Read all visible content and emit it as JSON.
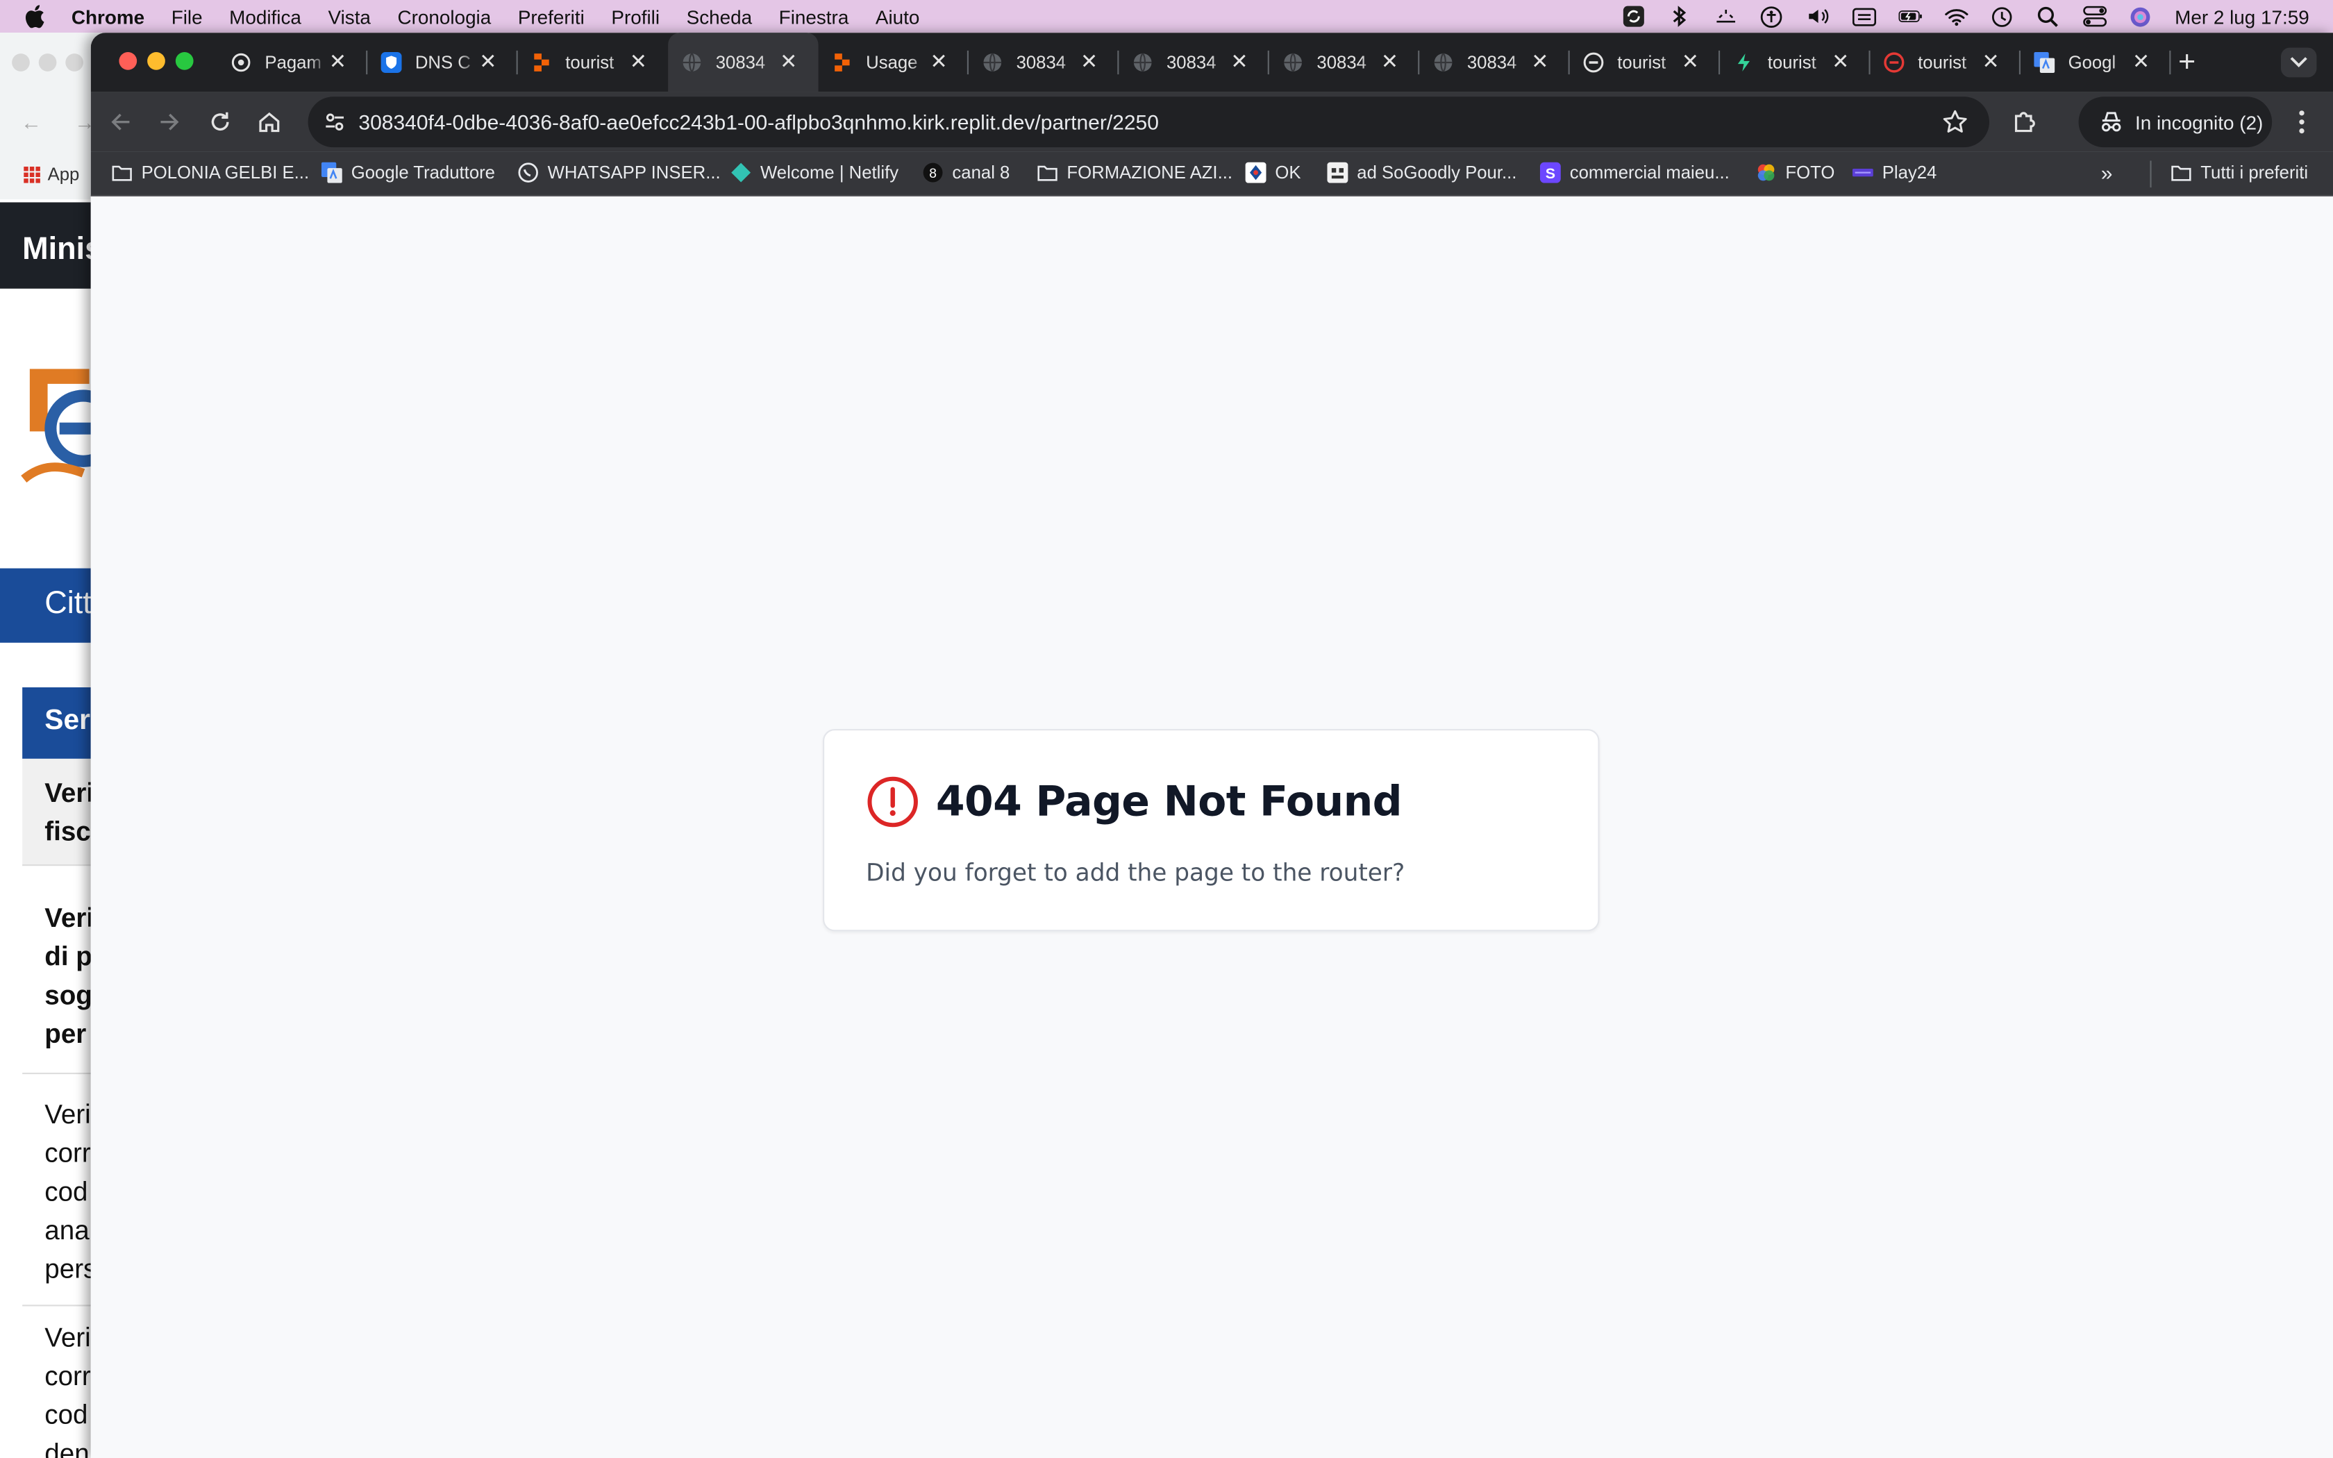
{
  "menubar": {
    "app_name": "Chrome",
    "items": [
      "File",
      "Modifica",
      "Vista",
      "Cronologia",
      "Preferiti",
      "Profili",
      "Scheda",
      "Finestra",
      "Aiuto"
    ],
    "clock": "Mer 2 lug  17:59"
  },
  "background_window": {
    "bookmark_apps": "App",
    "header": "Minis",
    "nav_label": "Citt",
    "section_label": "Ser",
    "blocks": [
      {
        "lines": [
          "Veri",
          "fisc"
        ]
      },
      {
        "lines": [
          "Veri",
          "di p",
          "sog",
          "per"
        ]
      },
      {
        "lines": [
          "Veri",
          "corr",
          "cod",
          "ana",
          "pers"
        ]
      },
      {
        "lines": [
          "Veri",
          "corr",
          "cod",
          "den"
        ]
      }
    ]
  },
  "tabs": [
    {
      "title": "Pagam",
      "icon": "openai-icon",
      "active": false
    },
    {
      "title": "DNS C",
      "icon": "shield-icon",
      "active": false
    },
    {
      "title": "tourist",
      "icon": "replit-icon",
      "active": false
    },
    {
      "title": "30834",
      "icon": "globe-icon",
      "active": true
    },
    {
      "title": "Usage",
      "icon": "replit-icon",
      "active": false
    },
    {
      "title": "30834",
      "icon": "globe-icon",
      "active": false
    },
    {
      "title": "30834",
      "icon": "globe-icon",
      "active": false
    },
    {
      "title": "30834",
      "icon": "globe-icon",
      "active": false
    },
    {
      "title": "30834",
      "icon": "globe-icon",
      "active": false
    },
    {
      "title": "tourist",
      "icon": "circle-logo-icon",
      "active": false
    },
    {
      "title": "tourist",
      "icon": "bolt-icon",
      "active": false
    },
    {
      "title": "tourist",
      "icon": "red-circle-icon",
      "active": false
    },
    {
      "title": "Googl",
      "icon": "google-translate-icon",
      "active": false
    }
  ],
  "toolbar": {
    "url": "308340f4-0dbe-4036-8af0-ae0efcc243b1-00-aflpbo3qnhmo.kirk.replit.dev/partner/2250",
    "incognito_label": "In incognito (2)"
  },
  "bookmarks": [
    {
      "label": "POLONIA GELBI E...",
      "icon": "folder-icon"
    },
    {
      "label": "Google Traduttore",
      "icon": "google-translate-icon"
    },
    {
      "label": "WHATSAPP INSER...",
      "icon": "whatsapp-icon"
    },
    {
      "label": "Welcome | Netlify",
      "icon": "netlify-icon"
    },
    {
      "label": "canal 8",
      "icon": "canal8-icon"
    },
    {
      "label": "FORMAZIONE AZI...",
      "icon": "folder-icon"
    },
    {
      "label": "OK",
      "icon": "ok-icon"
    },
    {
      "label": "ad SoGoodly Pour...",
      "icon": "sogoodly-icon"
    },
    {
      "label": "commercial maieu...",
      "icon": "s-icon"
    },
    {
      "label": "FOTO",
      "icon": "photos-icon"
    },
    {
      "label": "Play24",
      "icon": "play24-icon"
    }
  ],
  "bookmarks_more": "»",
  "all_bookmarks": "Tutti i preferiti",
  "page": {
    "title": "404 Page Not Found",
    "message": "Did you forget to add the page to the router?"
  },
  "colors": {
    "tab_strip": "#202124",
    "toolbar": "#35363a",
    "page_bg": "#f8f9fb",
    "alert_red": "#dc2626",
    "menubar": "#e4c6e6",
    "bg_site_blue": "#1a4c99"
  }
}
